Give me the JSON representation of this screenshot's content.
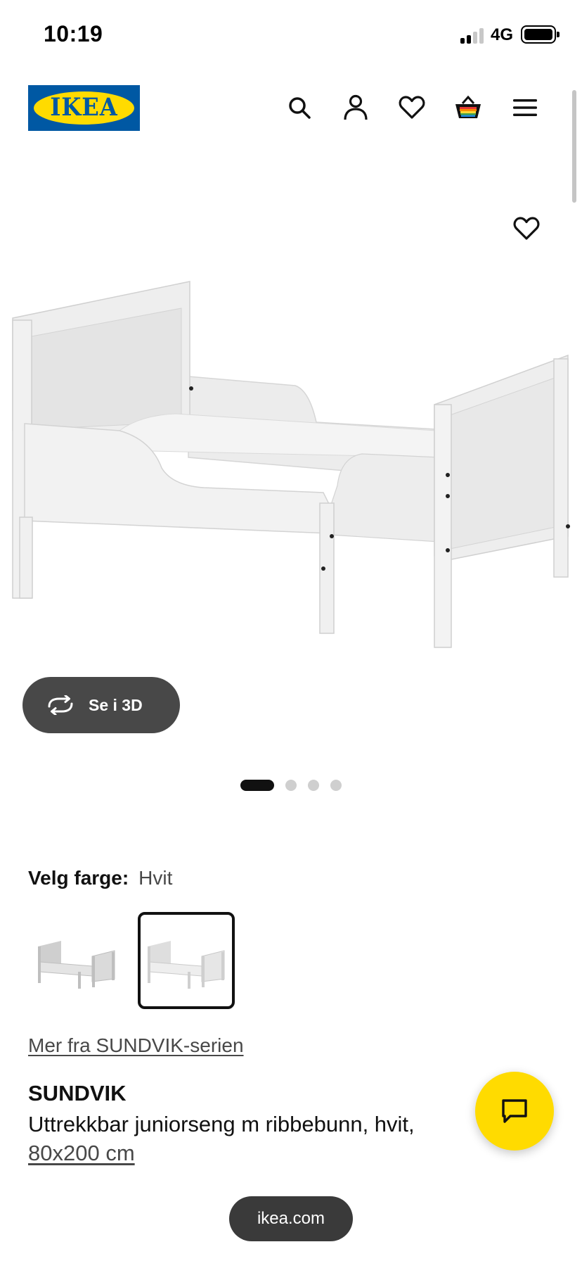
{
  "status_bar": {
    "time": "10:19",
    "network": "4G"
  },
  "header": {
    "logo_text": "IKEA",
    "icons": [
      "search-icon",
      "profile-icon",
      "heart-icon",
      "basket-icon",
      "menu-icon"
    ]
  },
  "gallery": {
    "view_3d_label": "Se i 3D",
    "page_count": 4,
    "active_page": 1
  },
  "color": {
    "label": "Velg farge:",
    "value": "Hvit",
    "selected_index": 1
  },
  "series_link": "Mer fra SUNDVIK-serien",
  "product": {
    "name": "SUNDVIK",
    "description": "Uttrekkbar juniorseng m ribbebunn, hvit,",
    "size": "80x200 cm"
  },
  "url_bar": {
    "host": "ikea.com"
  },
  "colors": {
    "ikea_blue": "#0058A3",
    "ikea_yellow": "#FFDB00",
    "pill_dark": "#484848"
  }
}
